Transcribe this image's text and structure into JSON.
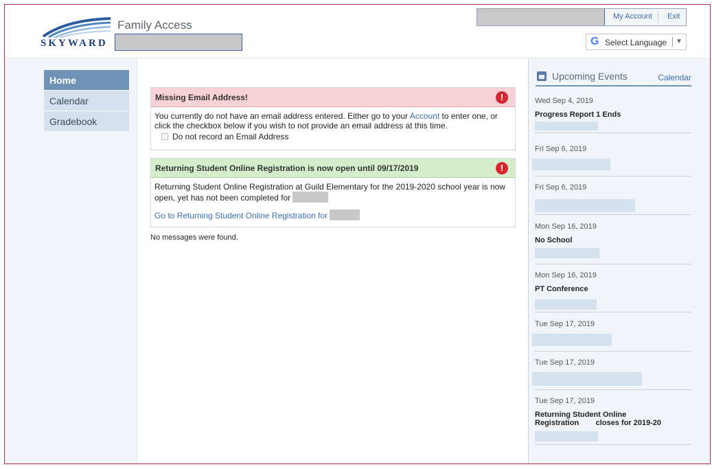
{
  "header": {
    "app_title": "Family Access",
    "logo_text": "SKYWARD",
    "my_account": "My Account",
    "exit": "Exit",
    "language": "Select Language",
    "language_arrow": "▼",
    "google_glyph": "G"
  },
  "nav": {
    "items": [
      {
        "label": "Home",
        "active": true
      },
      {
        "label": "Calendar",
        "active": false
      },
      {
        "label": "Gradebook",
        "active": false
      }
    ]
  },
  "messages": {
    "email": {
      "title": "Missing Email Address!",
      "body_pre": "You currently do not have an email address entered. Either go to your ",
      "account_link": "Account",
      "body_post": " to enter one, or click the checkbox below if you wish to not provide an email address at this time.",
      "checkbox_label": "Do not record an Email Address"
    },
    "registration": {
      "title": "Returning Student Online Registration is now open until 09/17/2019",
      "body": "Returning Student Online Registration at Guild Elementary for the 2019-2020 school year is now open, yet has not been completed for",
      "link": "Go to Returning Student Online Registration for"
    },
    "none": "No messages were found."
  },
  "events": {
    "title": "Upcoming Events",
    "calendar_link": "Calendar",
    "items": [
      {
        "date": "Wed Sep 4, 2019",
        "name": "Progress Report 1 Ends"
      },
      {
        "date": "Fri Sep 6, 2019",
        "name": ""
      },
      {
        "date": "Fri Sep 6, 2019",
        "name": ""
      },
      {
        "date": "Mon Sep 16, 2019",
        "name": "No School"
      },
      {
        "date": "Mon Sep 16, 2019",
        "name": "PT Conference"
      },
      {
        "date": "Tue Sep 17, 2019",
        "name": ""
      },
      {
        "date": "Tue Sep 17, 2019",
        "name": ""
      },
      {
        "date": "Tue Sep 17, 2019",
        "name": "Returning Student Online Registration        closes for 2019-20"
      }
    ]
  },
  "colors": {
    "nav_active": "#6f93b6",
    "nav_item": "#d3e1ee",
    "alert_red": "#d62832",
    "header_red_bg": "#f6d2d6",
    "header_green_bg": "#d4eecb",
    "link": "#3a6fb0"
  },
  "icons": {
    "alert": "alert-bubble-icon",
    "calendar": "calendar-icon",
    "google": "google-g-icon"
  }
}
